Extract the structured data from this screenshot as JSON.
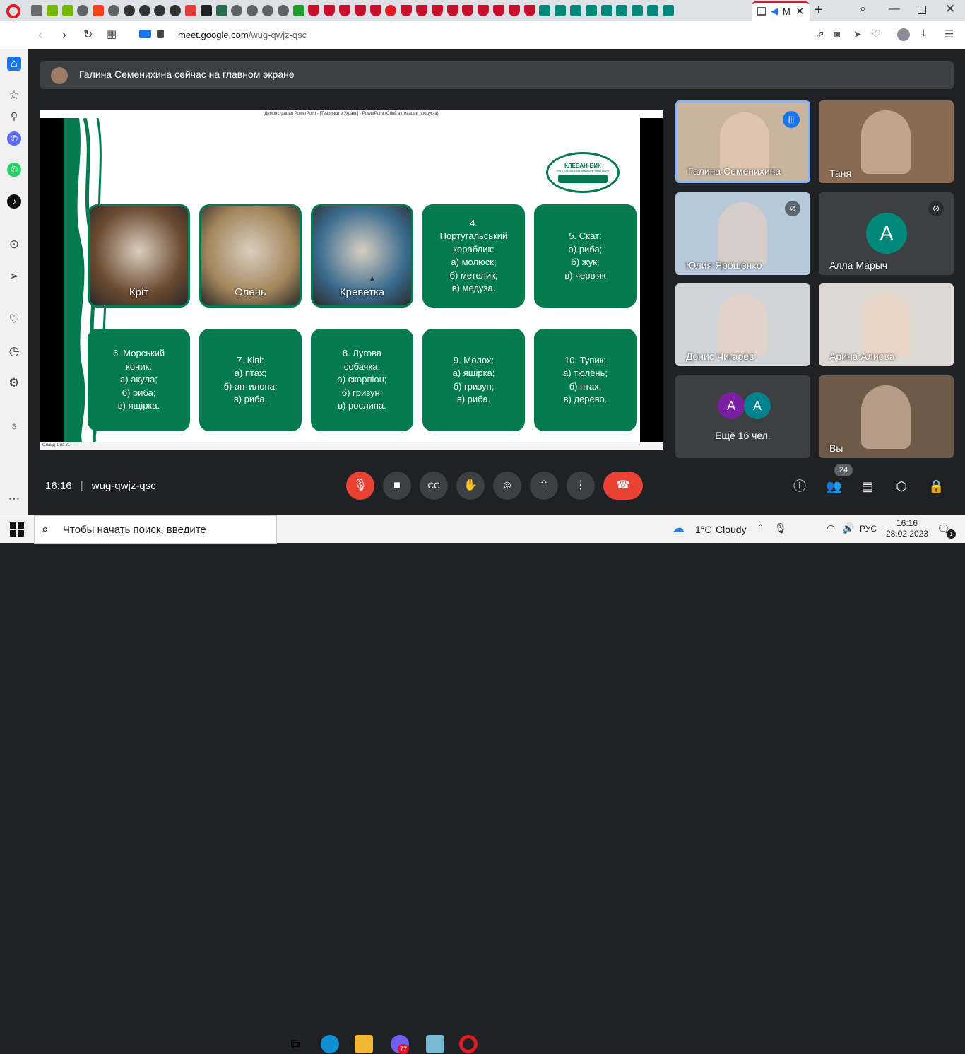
{
  "browser": {
    "active_tab_label": "M",
    "url_domain": "meet.google.com",
    "url_path": "/wug-qwjz-qsc",
    "tab_favicons": [
      "opera-logo",
      "box-icon",
      "nvidia-icon",
      "nvidia-icon",
      "globe-icon",
      "yandex-icon",
      "globe-icon",
      "wiki-icon",
      "wiki-icon",
      "wiki-icon",
      "wiki-icon",
      "chat-icon",
      "ex-icon",
      "rr-icon",
      "globe-icon",
      "globe-icon",
      "globe-icon",
      "globe-icon",
      "utorrent-icon",
      "mcafee-icon",
      "mcafee-icon",
      "mcafee-icon",
      "mcafee-icon",
      "mcafee-icon",
      "opera-icon",
      "mcafee-icon",
      "mcafee-icon",
      "mcafee-icon",
      "mcafee-icon",
      "mcafee-icon",
      "mcafee-icon",
      "mcafee-icon",
      "mcafee-icon",
      "mcafee-icon",
      "meet-icon",
      "meet-icon",
      "meet-icon",
      "meet-icon",
      "meet-icon",
      "meet-icon",
      "meet-icon",
      "meet-icon",
      "meet-icon"
    ]
  },
  "banner": {
    "text": "Галина Семенихина сейчас на главном экране"
  },
  "presentation": {
    "window_title": "Демонстрация PowerPoint - [Тваринки в Україні] - PowerPoint (Сбой активации продукта)",
    "status_text": "Слайд 1 из 21",
    "logo_text": "КЛЕБАН-БИК",
    "logo_subtext": "РЕГІОНАЛЬНИЙ ЛАНДШАФТНИЙ ПАРК",
    "cards_row1": [
      {
        "label": "Кріт",
        "kind": "image",
        "color": "#6b4a30"
      },
      {
        "label": "Олень",
        "kind": "image",
        "color": "#a2855a"
      },
      {
        "label": "Креветка",
        "kind": "image",
        "color": "#3a6b8e"
      },
      {
        "label": "4.\nПортугальський\nкораблик:\nа) молюск;\nб) метелик;\nв) медуза.",
        "kind": "text"
      },
      {
        "label": "5. Скат:\nа) риба;\nб) жук;\nв) черв'як",
        "kind": "text"
      }
    ],
    "cards_row2": [
      {
        "label": "6. Морський\nконик:\nа) акула;\nб) риба;\nв) ящірка.",
        "kind": "text"
      },
      {
        "label": "7. Ківі:\nа) птах;\nб) антилопа;\nв) риба.",
        "kind": "text"
      },
      {
        "label": "8. Лугова\nсобачка:\nа) скорпіон;\nб) гризун;\nв) рослина.",
        "kind": "text"
      },
      {
        "label": "9. Молох:\nа) ящірка;\nб) гризун;\nв) риба.",
        "kind": "text"
      },
      {
        "label": "10. Тупик:\nа) тюлень;\nб) птах;\nв) дерево.",
        "kind": "text"
      }
    ]
  },
  "participants": [
    {
      "name": "Галина Семенихина",
      "speaking": true,
      "muted": false
    },
    {
      "name": "Таня",
      "speaking": false,
      "muted": false
    },
    {
      "name": "Юлия Ярошенко",
      "speaking": false,
      "muted": true
    },
    {
      "name": "Алла Марыч",
      "speaking": false,
      "muted": true,
      "avatar_letter": "А",
      "avatar_color": "#00897b"
    },
    {
      "name": "Денис Чигарев",
      "speaking": false,
      "muted": false
    },
    {
      "name": "Арина Алиева",
      "speaking": false,
      "muted": false
    },
    {
      "name": "Ещё 16 чел.",
      "avatars": [
        "А",
        "А"
      ],
      "avatar_colors": [
        "#7b1fa2",
        "#00838f"
      ]
    },
    {
      "name": "Вы",
      "speaking": false,
      "muted": false
    }
  ],
  "meeting_bar": {
    "time": "16:16",
    "separator": "|",
    "code": "wug-qwjz-qsc",
    "participant_count": "24",
    "end_call_color": "#ea4335",
    "mic_off_color": "#ea4335"
  },
  "taskbar": {
    "search_placeholder": "Чтобы начать поиск, введите",
    "weather_temp": "1°C",
    "weather_desc": "Cloudy",
    "language": "РУС",
    "clock_time": "16:16",
    "clock_date": "28.02.2023",
    "viber_badge": "77",
    "notif_count": "1"
  }
}
